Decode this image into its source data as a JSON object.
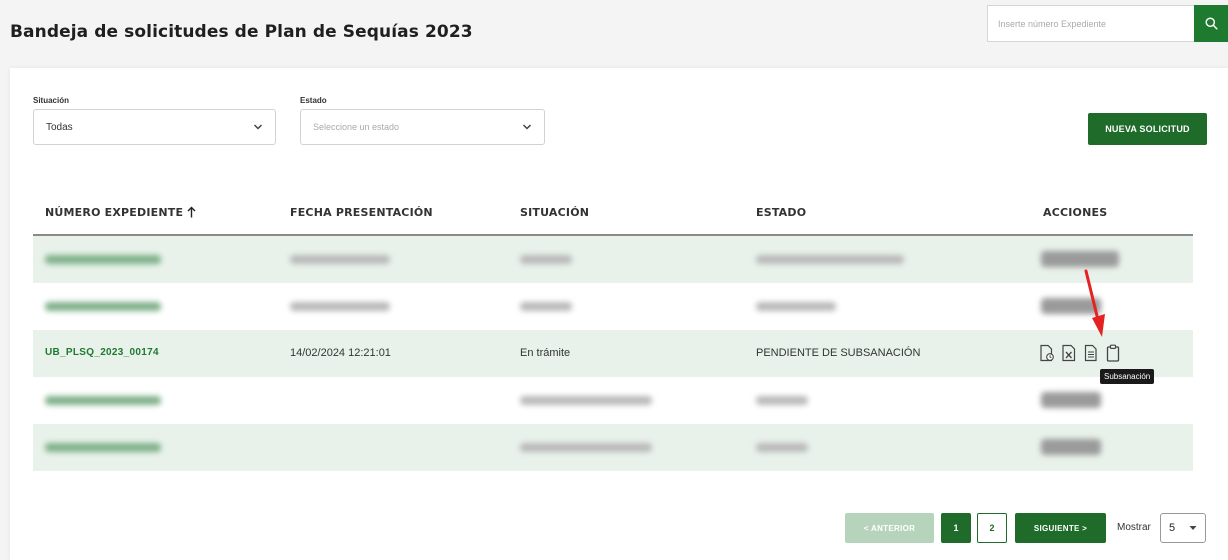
{
  "header": {
    "title": "Bandeja de solicitudes de Plan de Sequías 2023",
    "search_placeholder": "Inserte número Expediente",
    "search_icon": "search-icon"
  },
  "filters": {
    "situacion_label": "Situación",
    "situacion_value": "Todas",
    "estado_label": "Estado",
    "estado_placeholder": "Seleccione un estado"
  },
  "new_button_label": "NUEVA SOLICITUD",
  "table": {
    "columns": [
      "NÚMERO EXPEDIENTE",
      "FECHA PRESENTACIÓN",
      "SITUACIÓN",
      "ESTADO",
      "ACCIONES"
    ],
    "visible_row": {
      "expediente": "UB_PLSQ_2023_00174",
      "fecha": "14/02/2024 12:21:01",
      "situacion": "En trámite",
      "estado": "PENDIENTE DE SUBSANACIÓN",
      "actions": [
        "document-clock-icon",
        "excel-file-icon",
        "document-icon",
        "clipboard-icon"
      ]
    }
  },
  "tooltip": "Subsanación",
  "pagination": {
    "prev_label": "< ANTERIOR",
    "pages": [
      "1",
      "2"
    ],
    "active_page": "1",
    "next_label": "SIGUIENTE >",
    "show_label": "Mostrar",
    "show_value": "5"
  },
  "colors": {
    "primary_green": "#1e6b2a",
    "row_alt": "#e8f2ea",
    "annotation_arrow": "#e52222"
  }
}
